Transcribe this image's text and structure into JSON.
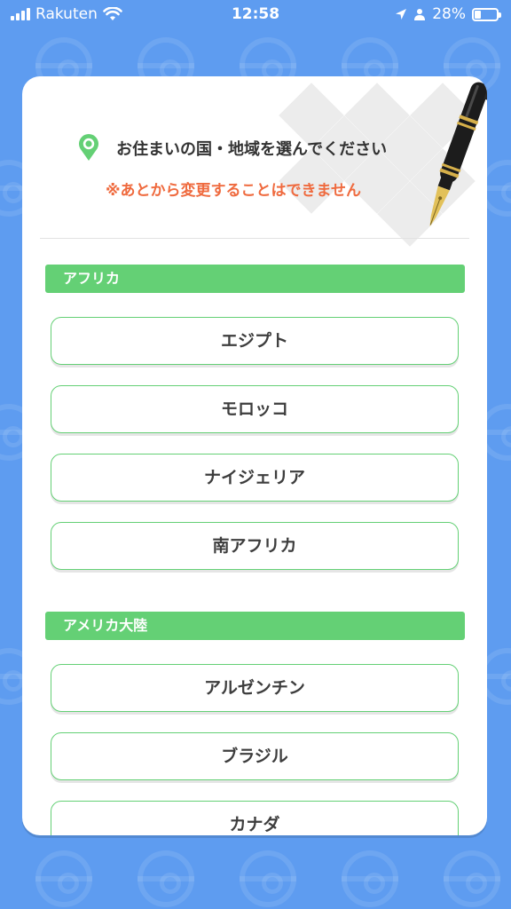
{
  "status_bar": {
    "carrier": "Rakuten",
    "time": "12:58",
    "battery": "28%",
    "battery_level": 0.28
  },
  "header": {
    "title": "お住まいの国・地域を選んでください",
    "warning": "※あとから変更することはできません",
    "title_icon": "location-pin-icon",
    "decoration_icon": "fountain-pen-icon"
  },
  "regions": [
    {
      "name": "アフリカ",
      "countries": [
        "エジプト",
        "モロッコ",
        "ナイジェリア",
        "南アフリカ"
      ]
    },
    {
      "name": "アメリカ大陸",
      "countries": [
        "アルゼンチン",
        "ブラジル",
        "カナダ"
      ]
    }
  ],
  "colors": {
    "background": "#5e9cf0",
    "accent_green": "#64d075",
    "warning_orange": "#ef6a3e",
    "text": "#333333"
  }
}
